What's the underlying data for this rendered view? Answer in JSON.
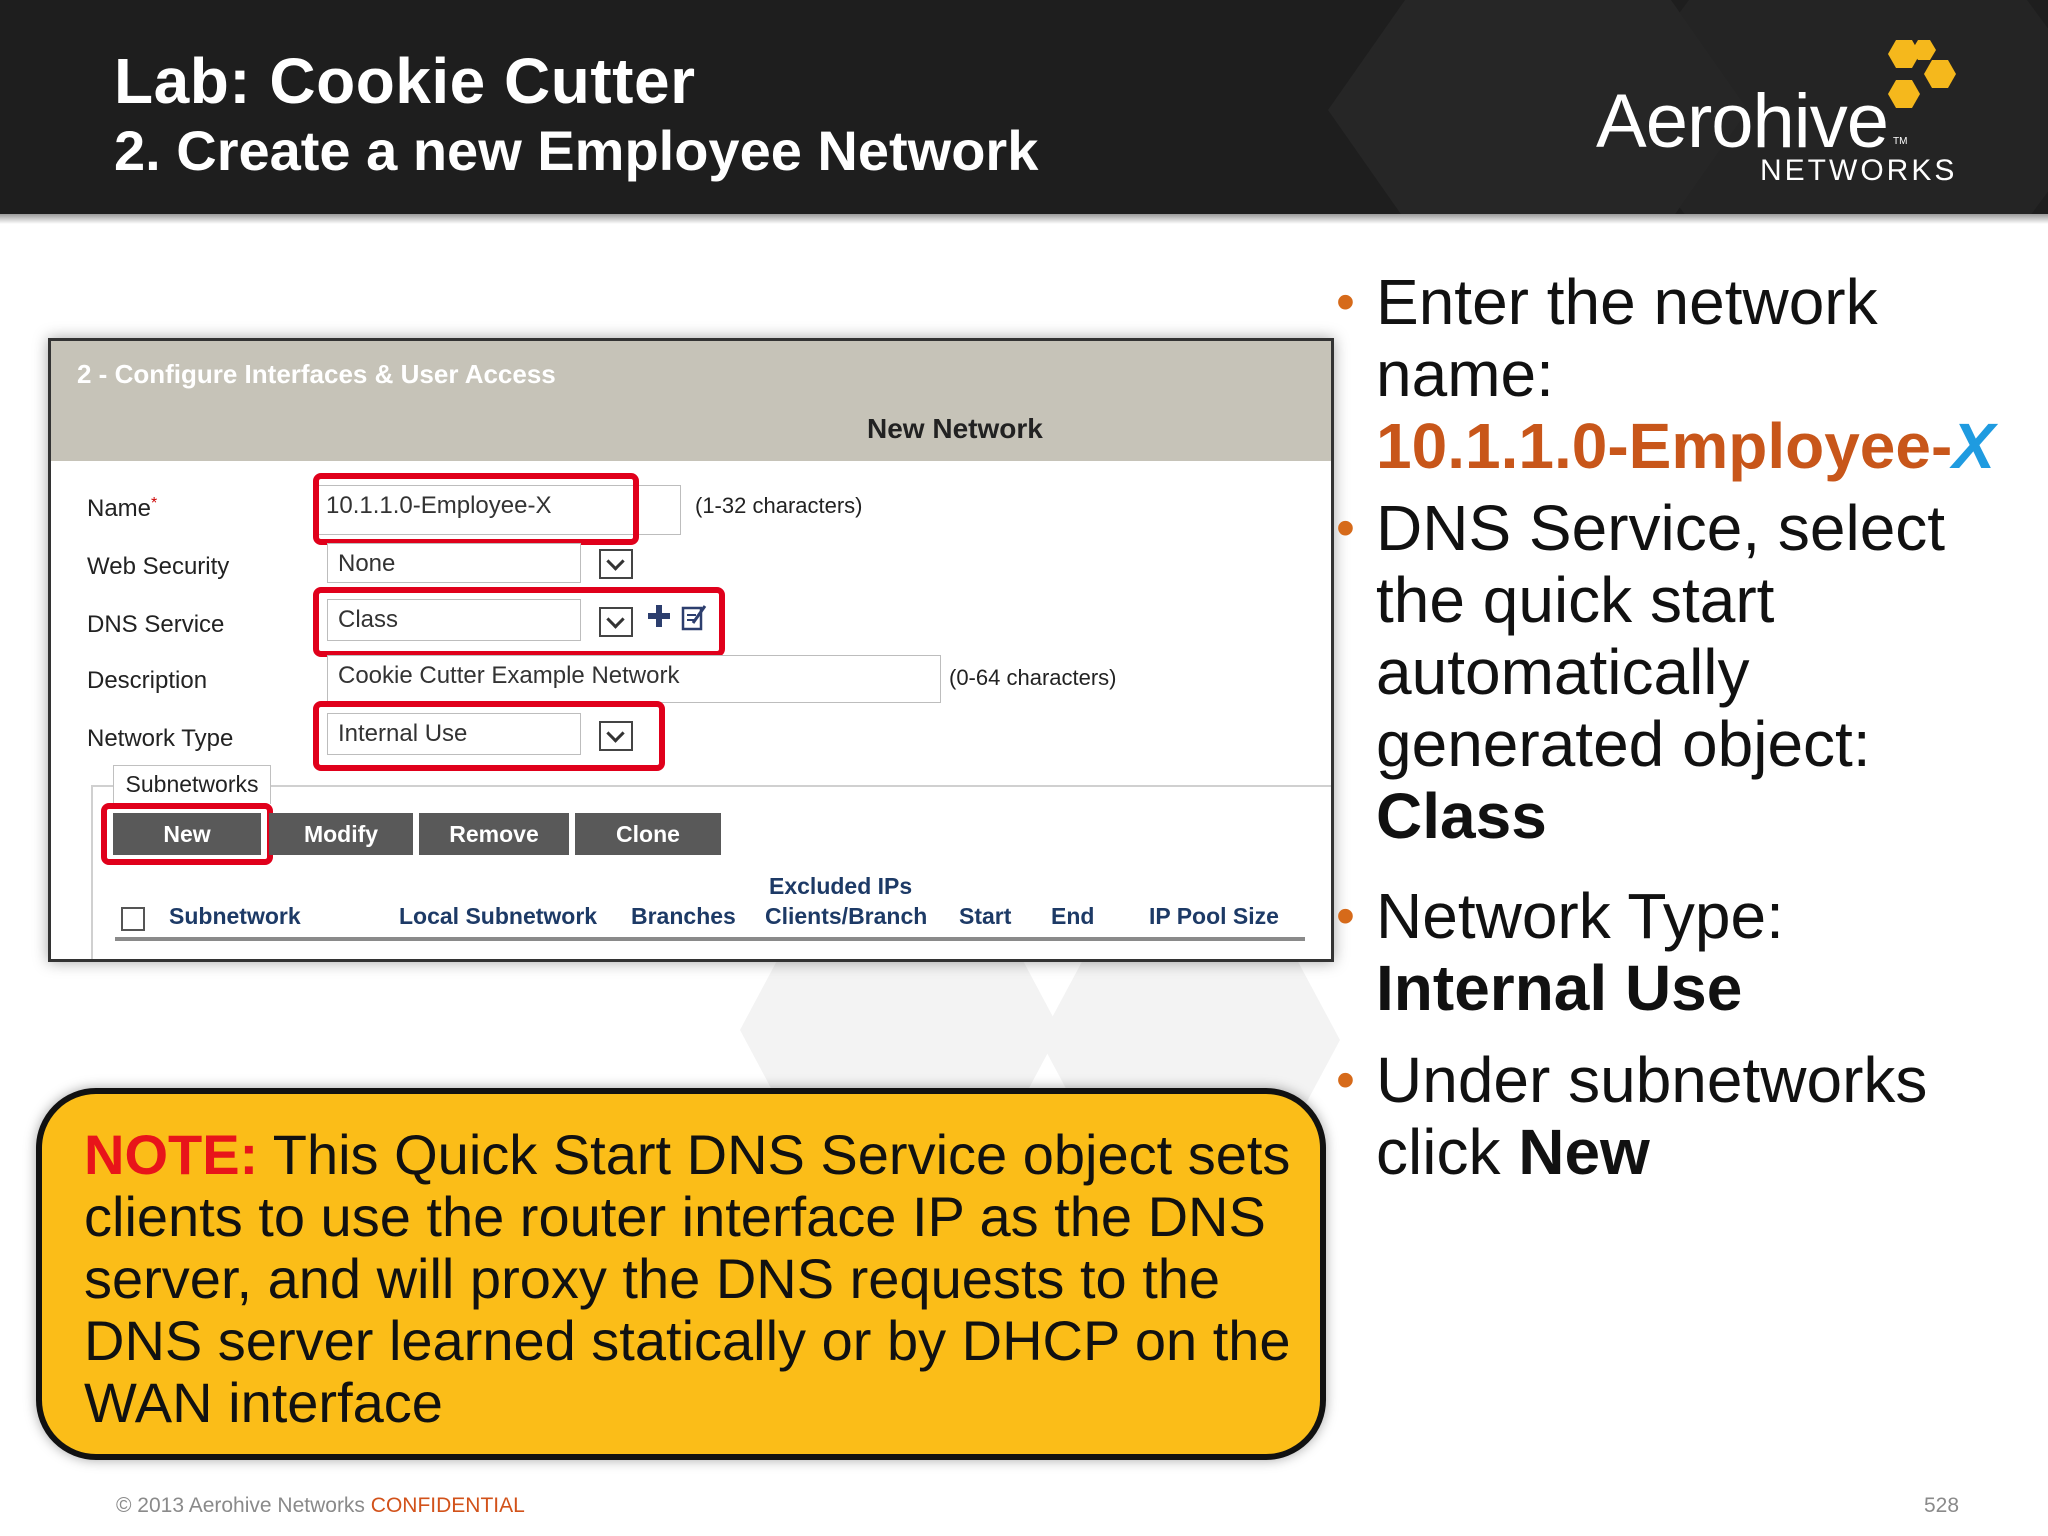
{
  "header": {
    "title": "Lab: Cookie Cutter",
    "subtitle": "2. Create a new Employee Network",
    "logo_word": "Aerohive",
    "logo_tm": "TM",
    "logo_sub": "NETWORKS"
  },
  "panel": {
    "step_title": "2 - Configure Interfaces & User Access",
    "section_title": "New Network",
    "fields": {
      "name_label": "Name",
      "name_required": "*",
      "name_value": "10.1.1.0-Employee-X",
      "name_hint": "(1-32 characters)",
      "web_security_label": "Web Security",
      "web_security_value": "None",
      "dns_label": "DNS Service",
      "dns_value": "Class",
      "description_label": "Description",
      "description_value": "Cookie Cutter Example Network",
      "description_hint": "(0-64 characters)",
      "network_type_label": "Network Type",
      "network_type_value": "Internal Use"
    },
    "tab_label": "Subnetworks",
    "buttons": {
      "new": "New",
      "modify": "Modify",
      "remove": "Remove",
      "clone": "Clone"
    },
    "columns": {
      "subnetwork": "Subnetwork",
      "local_subnetwork": "Local Subnetwork",
      "branches": "Branches",
      "excluded_ips_line1": "Excluded IPs",
      "excluded_ips_line2": "Clients/Branch",
      "start": "Start",
      "end": "End",
      "ip_pool_size": "IP Pool Size"
    }
  },
  "bullets": {
    "b1_text": "Enter the network name:",
    "b1_value": "10.1.1.0-Employee-",
    "b1_x": "X",
    "b2_text": "DNS Service, select the quick start automatically generated object:",
    "b2_value": "Class",
    "b3_text": "Network Type:",
    "b3_value": "Internal Use",
    "b4_text": "Under subnetworks click",
    "b4_value": "New"
  },
  "note": {
    "label": "NOTE:",
    "text": "This Quick Start DNS Service object sets clients to use the router interface IP as the DNS server, and will proxy the DNS requests to the DNS server learned statically or by DHCP on the WAN interface"
  },
  "footer": {
    "copyright": "© 2013 Aerohive Networks",
    "confidential": "CONFIDENTIAL",
    "page": "528"
  },
  "colors": {
    "header_bg": "#1e1e1e",
    "accent_orange": "#c8561a",
    "note_yellow": "#fbbd18",
    "highlight_red": "#e0001b",
    "logo_yellow": "#f5b81c"
  }
}
